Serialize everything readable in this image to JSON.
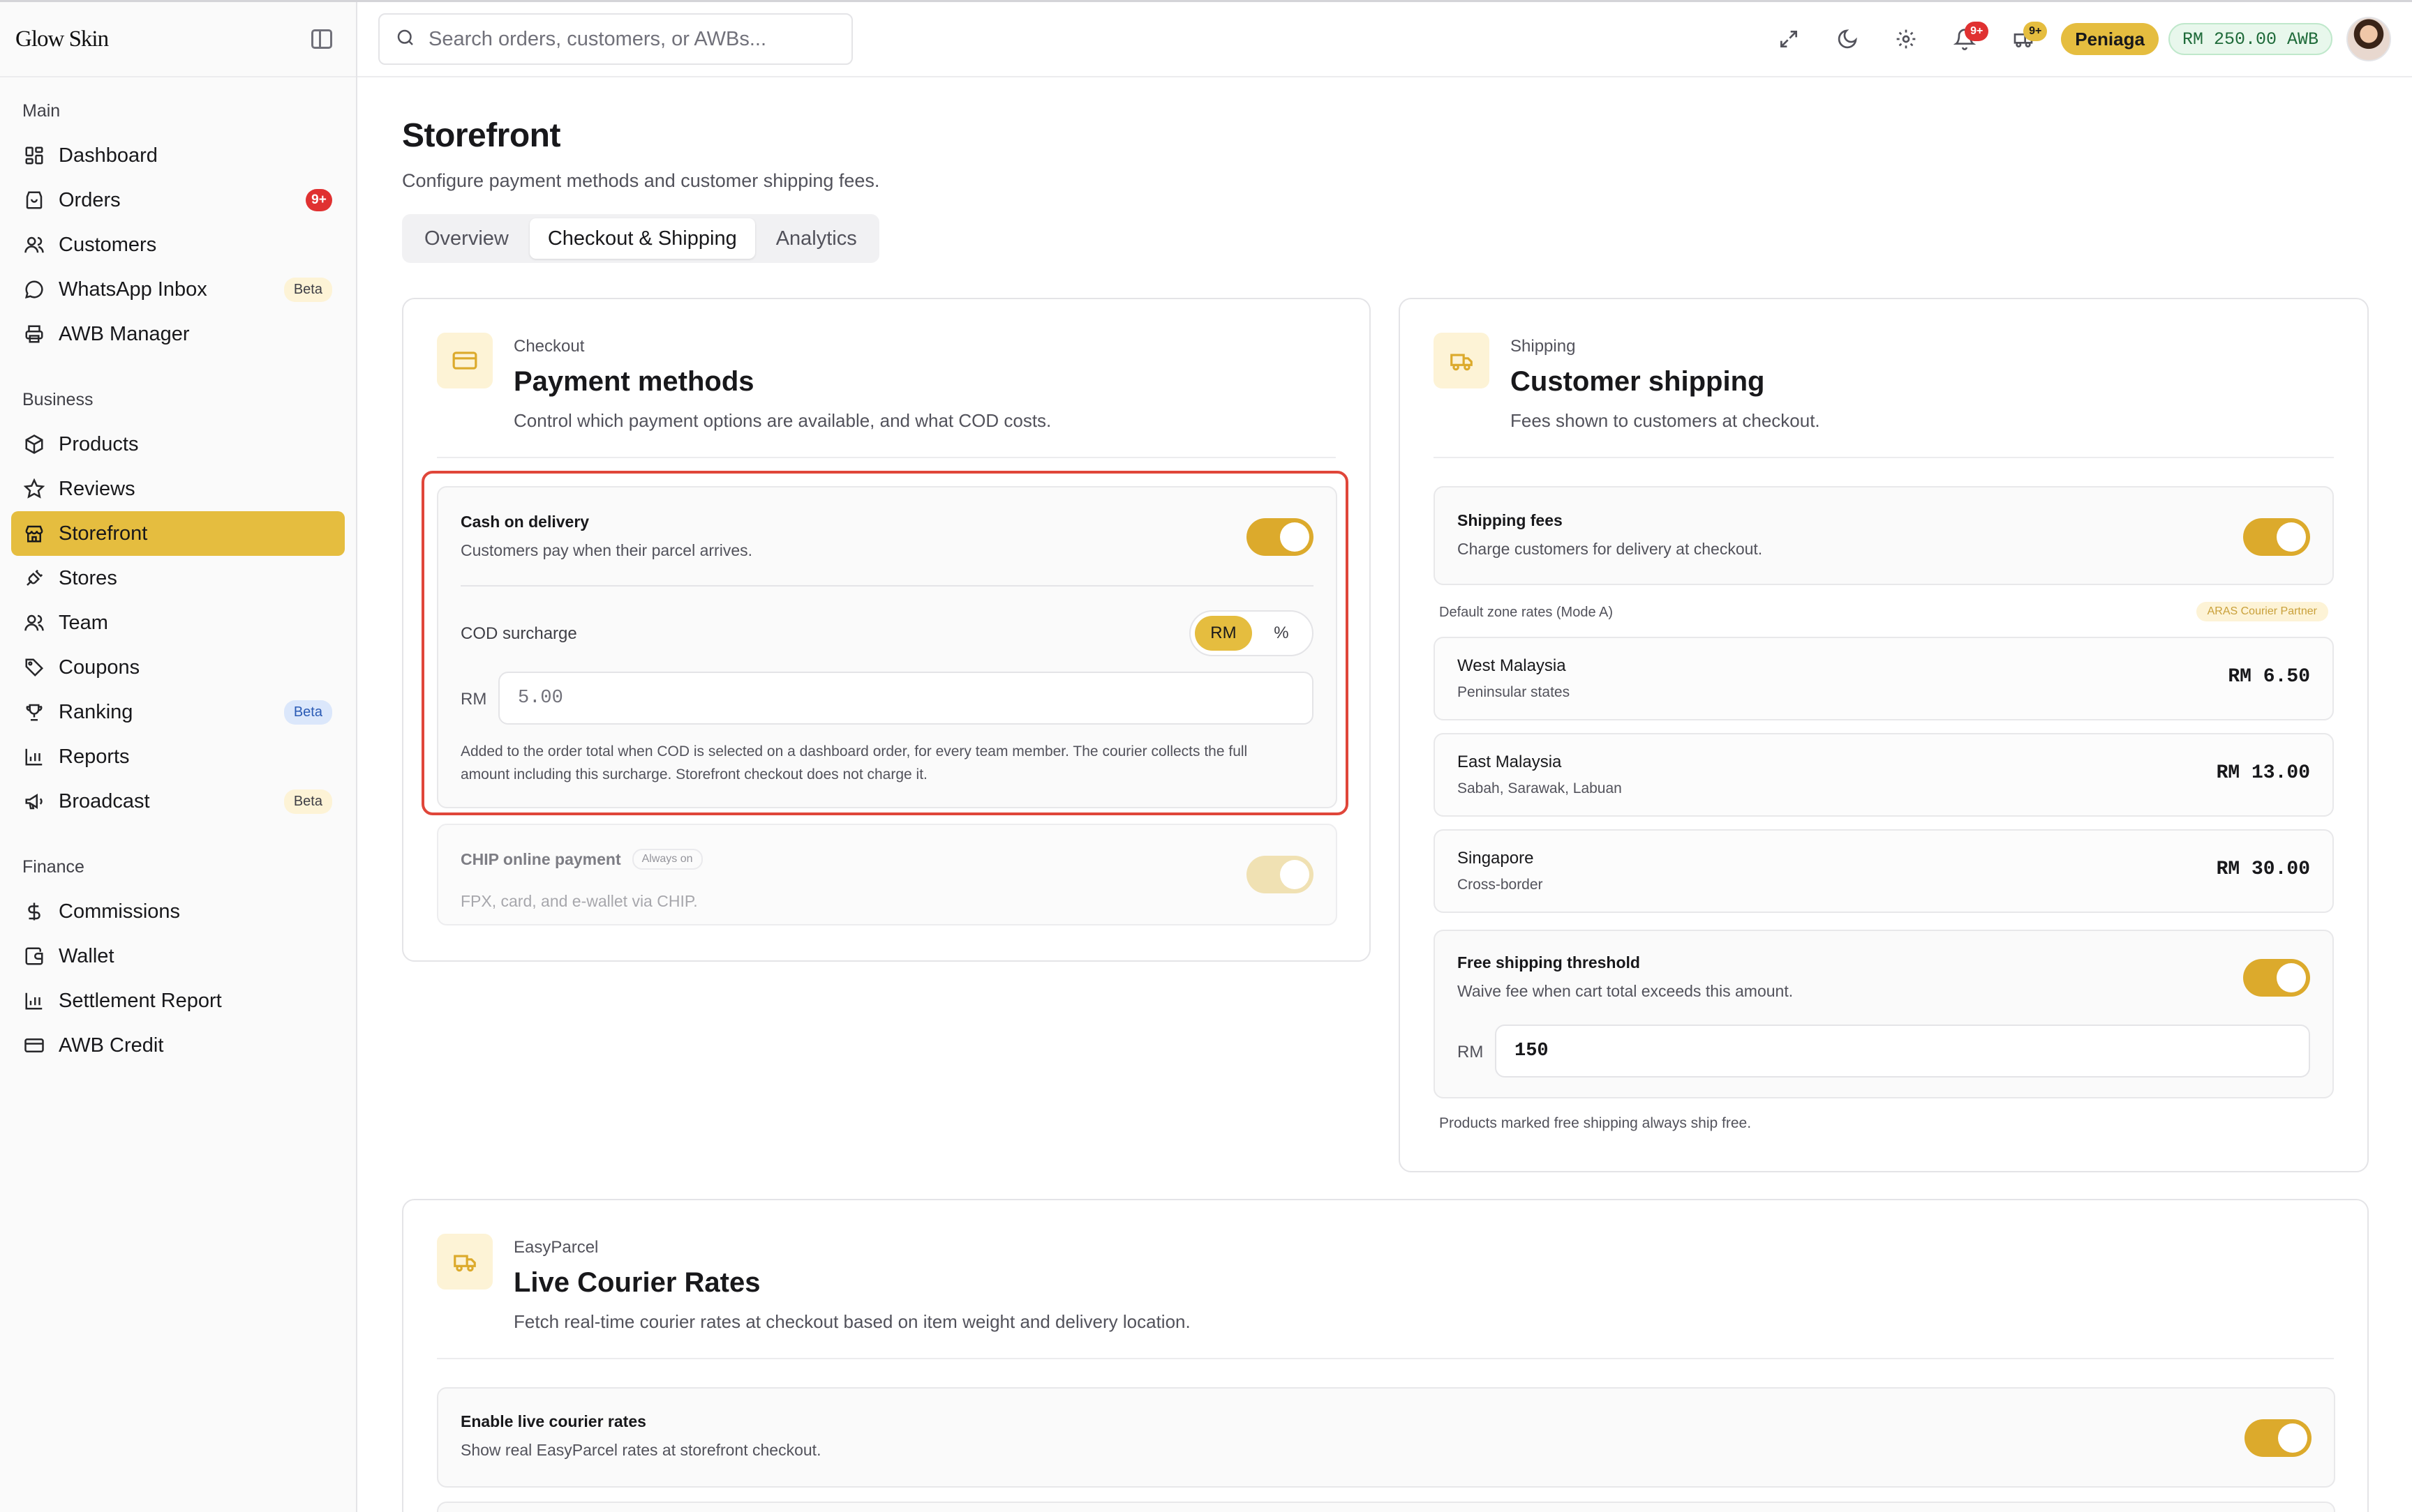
{
  "brand": "Glow Skin",
  "sidebar": {
    "sections": [
      {
        "title": "Main",
        "items": [
          {
            "label": "Dashboard",
            "icon": "dashboard-icon"
          },
          {
            "label": "Orders",
            "icon": "orders-icon",
            "badge": "9+"
          },
          {
            "label": "Customers",
            "icon": "customers-icon"
          },
          {
            "label": "WhatsApp Inbox",
            "icon": "chat-icon",
            "beta": "Beta"
          },
          {
            "label": "AWB Manager",
            "icon": "printer-icon"
          }
        ]
      },
      {
        "title": "Business",
        "items": [
          {
            "label": "Products",
            "icon": "box-icon"
          },
          {
            "label": "Reviews",
            "icon": "star-icon"
          },
          {
            "label": "Storefront",
            "icon": "store-icon",
            "active": true
          },
          {
            "label": "Stores",
            "icon": "plug-icon"
          },
          {
            "label": "Team",
            "icon": "team-icon"
          },
          {
            "label": "Coupons",
            "icon": "tag-icon"
          },
          {
            "label": "Ranking",
            "icon": "trophy-icon",
            "beta": "Beta"
          },
          {
            "label": "Reports",
            "icon": "bar-chart-icon"
          },
          {
            "label": "Broadcast",
            "icon": "megaphone-icon",
            "beta": "Beta"
          }
        ]
      },
      {
        "title": "Finance",
        "items": [
          {
            "label": "Commissions",
            "icon": "dollar-icon"
          },
          {
            "label": "Wallet",
            "icon": "wallet-icon"
          },
          {
            "label": "Settlement Report",
            "icon": "bar-chart-icon"
          },
          {
            "label": "AWB Credit",
            "icon": "credit-card-icon"
          }
        ]
      }
    ]
  },
  "topbar": {
    "search_placeholder": "Search orders, customers, or AWBs...",
    "notifications_badge": "9+",
    "shipments_badge": "9+",
    "plan_label": "Peniaga",
    "awb_balance": "RM 250.00 AWB"
  },
  "page": {
    "title": "Storefront",
    "subtitle": "Configure payment methods and customer shipping fees.",
    "tabs": [
      "Overview",
      "Checkout & Shipping",
      "Analytics"
    ]
  },
  "checkout": {
    "eyebrow": "Checkout",
    "title": "Payment methods",
    "description": "Control which payment options are available, and what COD costs.",
    "cod": {
      "title": "Cash on delivery",
      "subtitle": "Customers pay when their parcel arrives.",
      "enabled": true,
      "surcharge_label": "COD surcharge",
      "unit_rm": "RM",
      "unit_pct": "%",
      "prefix": "RM",
      "placeholder": "5.00",
      "help": "Added to the order total when COD is selected on a dashboard order, for every team member. The courier collects the full amount including this surcharge. Storefront checkout does not charge it."
    },
    "chip": {
      "title": "CHIP online payment",
      "chip_label": "Always on",
      "subtitle": "FPX, card, and e-wallet via CHIP.",
      "enabled": true
    }
  },
  "shipping": {
    "eyebrow": "Shipping",
    "title": "Customer shipping",
    "description": "Fees shown to customers at checkout.",
    "fees": {
      "title": "Shipping fees",
      "subtitle": "Charge customers for delivery at checkout.",
      "enabled": true
    },
    "zone_label": "Default zone rates (Mode A)",
    "partner_label": "ARAS Courier Partner",
    "zones": [
      {
        "name": "West Malaysia",
        "sub": "Peninsular states",
        "rate": "RM 6.50"
      },
      {
        "name": "East Malaysia",
        "sub": "Sabah, Sarawak, Labuan",
        "rate": "RM 13.00"
      },
      {
        "name": "Singapore",
        "sub": "Cross-border",
        "rate": "RM 30.00"
      }
    ],
    "free": {
      "title": "Free shipping threshold",
      "subtitle": "Waive fee when cart total exceeds this amount.",
      "enabled": true,
      "prefix": "RM",
      "value": "150"
    },
    "note": "Products marked free shipping always ship free."
  },
  "live": {
    "eyebrow": "EasyParcel",
    "title": "Live Courier Rates",
    "description": "Fetch real-time courier rates at checkout based on item weight and delivery location.",
    "enable": {
      "title": "Enable live courier rates",
      "subtitle": "Show real EasyParcel rates at storefront checkout.",
      "enabled": true
    }
  },
  "colors": {
    "accent": "#e5bd3f",
    "toggle": "#dcaa2c",
    "highlight": "#e0463a",
    "badge": "#e03131"
  }
}
